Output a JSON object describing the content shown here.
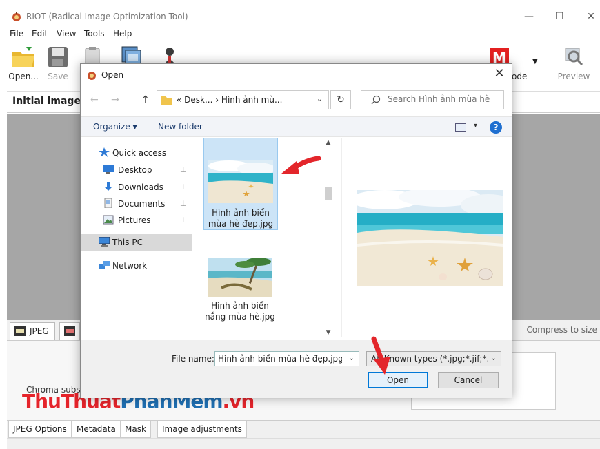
{
  "app": {
    "title": "RIOT (Radical Image Optimization Tool)",
    "window_controls": {
      "minimize": "—",
      "maximize": "☐",
      "close": "✕"
    },
    "menu": [
      "File",
      "Edit",
      "View",
      "Tools",
      "Help"
    ],
    "toolbar": {
      "open_label": "Open...",
      "save_label": "Save",
      "mode_label": "ode",
      "preview_label": "Preview",
      "mode_icon_letter": "M"
    },
    "initial_image_label": "Initial image:",
    "format_tabs": [
      "JPEG",
      ""
    ],
    "compress_label": "Compress to size",
    "chroma_label": "Chroma subs",
    "bottom_tabs": [
      "JPEG Options",
      "Metadata",
      "Mask",
      "Image adjustments"
    ]
  },
  "watermark": {
    "part1": "ThuThuat",
    "part2": "PhanMem",
    "part3": ".vn"
  },
  "dialog": {
    "title": "Open",
    "close": "✕",
    "nav": {
      "back": "←",
      "forward": "→",
      "up": "↑"
    },
    "address": {
      "prefix": "«",
      "crumb1": "Desk...",
      "sep": "›",
      "crumb2": "Hình ảnh mù...",
      "chevron": "⌄",
      "refresh": "↻"
    },
    "search": {
      "placeholder": "Search Hình ảnh mùa hè"
    },
    "commands": {
      "organize": "Organize ▾",
      "new_folder": "New folder",
      "help": "?",
      "view_chevron": "▾"
    },
    "nav_pane": [
      {
        "label": "Quick access",
        "pinned": false
      },
      {
        "label": "Desktop",
        "pinned": true
      },
      {
        "label": "Downloads",
        "pinned": true
      },
      {
        "label": "Documents",
        "pinned": true
      },
      {
        "label": "Pictures",
        "pinned": true
      },
      {
        "label": "This PC",
        "pinned": false
      },
      {
        "label": "Network",
        "pinned": false
      }
    ],
    "pin_glyph": "📌",
    "files": [
      {
        "name_line1": "Hình ảnh biển",
        "name_line2": "mùa hè đẹp.jpg",
        "selected": true
      },
      {
        "name_line1": "Hình ảnh biển",
        "name_line2": "nắng mùa hè.jpg",
        "selected": false
      }
    ],
    "scroll": {
      "up": "▲",
      "down": "▼"
    },
    "file_name_label": "File name:",
    "file_name_value": "Hình ảnh biển mùa hè đẹp.jpg",
    "file_type_value": "All Known types (*.jpg;*.jif;*.jpe",
    "open_button": "Open",
    "cancel_button": "Cancel",
    "dropdown_chevron": "⌄"
  }
}
